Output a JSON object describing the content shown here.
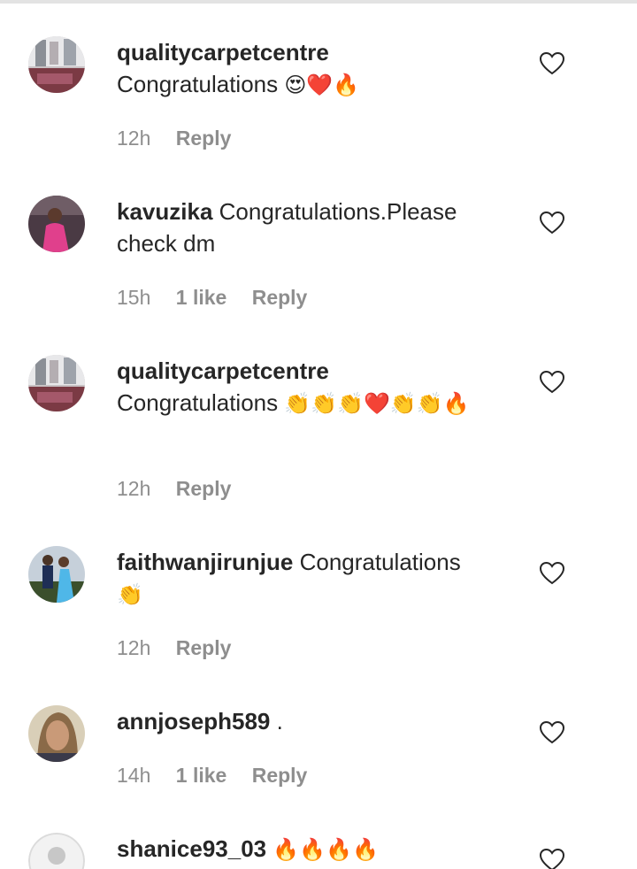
{
  "comments": [
    {
      "username": "qualitycarpetcentre",
      "text": "Congratulations",
      "emoji": "😍❤️🔥",
      "time": "12h",
      "likes": "",
      "reply": "Reply",
      "avatar": "carpet-avatar"
    },
    {
      "username": "kavuzika",
      "text": "Congratulations.Please check dm",
      "emoji": "",
      "time": "15h",
      "likes": "1 like",
      "reply": "Reply",
      "avatar": "pink-dress-avatar"
    },
    {
      "username": "qualitycarpetcentre",
      "text": "Congratulations",
      "emoji": "👏👏👏❤️👏👏🔥",
      "time": "12h",
      "likes": "",
      "reply": "Reply",
      "avatar": "carpet-avatar"
    },
    {
      "username": "faithwanjirunjue",
      "text": "Congratulations",
      "emoji": "👏",
      "time": "12h",
      "likes": "",
      "reply": "Reply",
      "avatar": "people-avatar"
    },
    {
      "username": "annjoseph589",
      "text": ".",
      "emoji": "",
      "time": "14h",
      "likes": "1 like",
      "reply": "Reply",
      "avatar": "portrait-avatar"
    },
    {
      "username": "shanice93_03",
      "text": "",
      "emoji": "🔥🔥🔥🔥",
      "time": "",
      "likes": "",
      "reply": "",
      "avatar": "default-avatar"
    }
  ],
  "icons": {
    "like": "heart-outline-icon"
  },
  "colors": {
    "text": "#262626",
    "meta": "#8e8e8e",
    "divider": "#e3e3e3"
  }
}
